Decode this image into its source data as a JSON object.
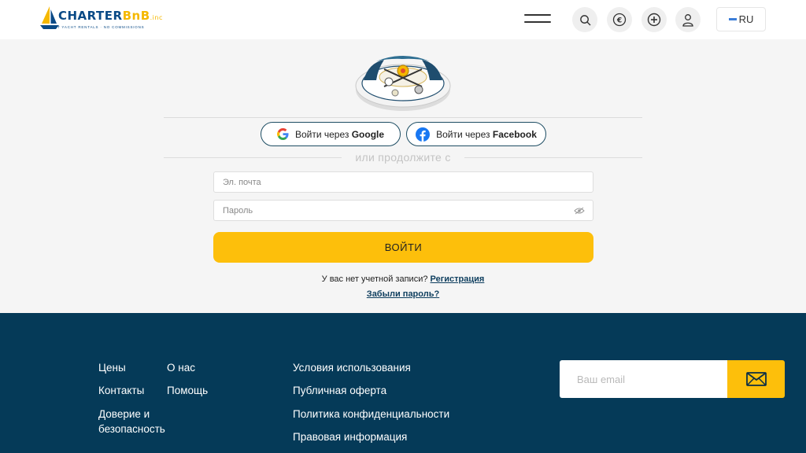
{
  "header": {
    "logo": {
      "word_main": "CHARTER",
      "word_accent": "BnB",
      "word_suffix": ".inc",
      "tagline": "DIRECT YACHT RENTALS · NO COMMISSIONS"
    },
    "language": "RU",
    "icons": [
      "menu-icon",
      "search-icon",
      "euro-icon",
      "add-circle-icon",
      "user-icon"
    ]
  },
  "auth": {
    "google_prefix": "Войти через",
    "google_brand": "Google",
    "facebook_prefix": "Войти через",
    "facebook_brand": "Facebook",
    "or_text": "или продолжите с",
    "email_placeholder": "Эл. почта",
    "password_placeholder": "Пароль",
    "login_label": "ВОЙТИ",
    "no_account_text": "У вас нет учетной записи?",
    "register_link": "Регистрация",
    "forgot_link": "Забыли пароль?"
  },
  "footer": {
    "col1": [
      "Цены",
      "Контакты",
      "Доверие и безопасность"
    ],
    "col2": [
      "О нас",
      "Помощь"
    ],
    "col3": [
      "Условия использования",
      "Публичная оферта",
      "Политика конфиденциальности",
      "Правовая информация"
    ],
    "subscribe_placeholder": "Ваш email"
  },
  "colors": {
    "accent_yellow": "#fdbf0b",
    "footer_bg": "#053a58",
    "link_dark": "#0e3e5e",
    "facebook_blue": "#1877f2"
  }
}
